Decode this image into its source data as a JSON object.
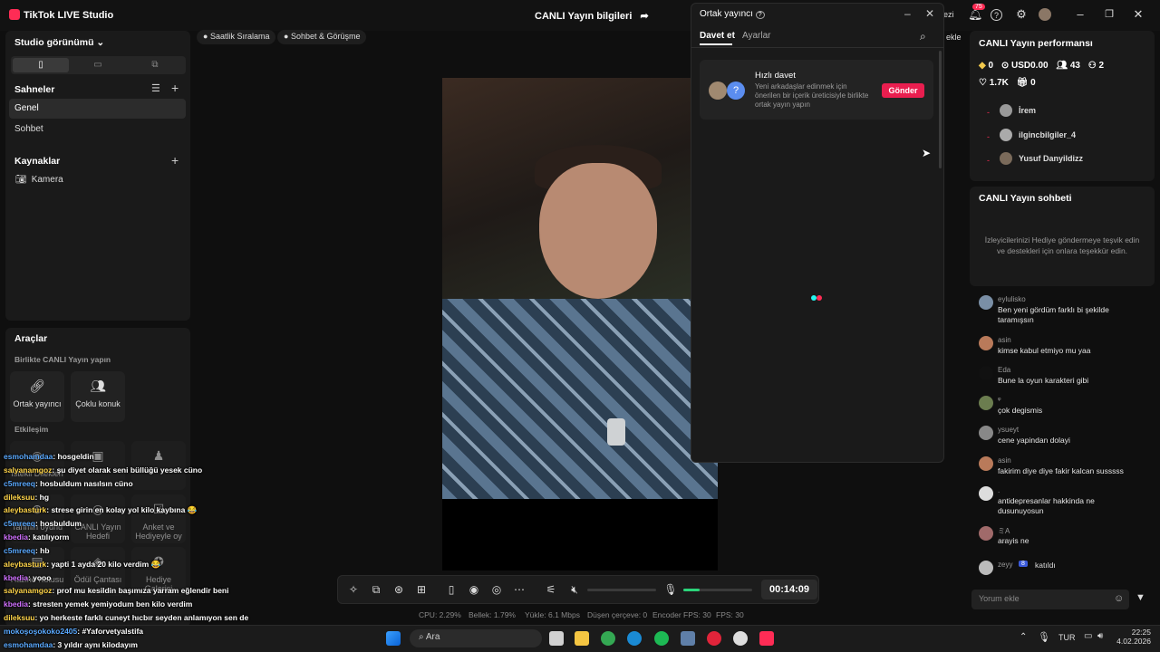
{
  "app": {
    "title": "TikTok LIVE Studio",
    "center_title": "CANLI Yayın bilgileri"
  },
  "top_right": {
    "notif_count": "75",
    "partial_text": "ezi",
    "partial_add": "ekle"
  },
  "left": {
    "studio_view": "Studio görünümü",
    "scenes_title": "Sahneler",
    "scenes": [
      "Genel",
      "Sohbet"
    ],
    "sources_title": "Kaynaklar",
    "sources": [
      "Kamera"
    ],
    "tools_title": "Araçlar",
    "collab_title": "Birlikte CANLI Yayın yapın",
    "collab_tools": [
      "Ortak yayıncı",
      "Çoklu konuk"
    ],
    "interaction_title": "Etkileşim",
    "interaction_tools": [
      "İstekli Dilekleri",
      "",
      "",
      "Tahmin oyunu",
      "CANLI Yayın Hedefi",
      "Anket ve Hediyeyle oy",
      "Hazine Kutusu",
      "Ödül Çantası",
      "Hediye Galerisi"
    ]
  },
  "chips": [
    "Saatlik Sıralama",
    "Sohbet & Görüşme"
  ],
  "modal": {
    "title": "Ortak yayıncı",
    "tabs": [
      "Davet et",
      "Ayarlar"
    ],
    "card_title": "Hızlı davet",
    "card_desc": "Yeni arkadaşlar edinmek için önerilen bir içerik üreticisiyle birlikte ortak yayın yapın",
    "send": "Gönder"
  },
  "controls": {
    "timer": "00:14:09"
  },
  "stats": [
    "CPU: 2.29%",
    "Bellek: 1.79%",
    "Yükle: 6.1 Mbps",
    "Düşen çerçeve: 0",
    "Encoder FPS: 30",
    "FPS: 30"
  ],
  "perf": {
    "title": "CANLI Yayın performansı",
    "diamonds": "0",
    "usd": "USD0.00",
    "viewers": "43",
    "followers": "2",
    "likes": "1.7K",
    "gifts": "0",
    "viewers_list": [
      "İrem",
      "ilgincbilgiler_4",
      "Yusuf Danyildizz"
    ]
  },
  "chat": {
    "title": "CANLI Yayın sohbeti",
    "empty": "İzleyicilerinizi Hediye göndermeye teşvik edin ve destekleri için onlara teşekkür edin.",
    "messages": [
      {
        "user": "eylulisko",
        "text": "Ben yeni gördüm farklı bi şekilde taramışsın"
      },
      {
        "user": "asin",
        "text": "kimse kabul etmiyo mu yaa"
      },
      {
        "user": "Eda",
        "text": "Bune la oyun karakteri gibi"
      },
      {
        "user": "ᵠ",
        "text": "çok degismis"
      },
      {
        "user": "ysueyt",
        "text": "cene yapindan dolayi"
      },
      {
        "user": "asin",
        "text": "fakirim diye diye fakir kalcan susssss"
      },
      {
        "user": ".",
        "text": "antidepresanlar hakkinda ne dusunuyosun"
      },
      {
        "user": "ミA",
        "text": "arayis ne"
      },
      {
        "user": "zeyy",
        "text": "katıldı"
      }
    ],
    "join_badge": "8",
    "comment_placeholder": "Yorum ekle"
  },
  "overlay_chat": [
    {
      "user": "esmohamdaa",
      "text": ": hosgeldin"
    },
    {
      "user": "salyanamgoz",
      "text": ": şu diyet olarak seni büllüğü yesek cüno"
    },
    {
      "user": "c5mreeq",
      "text": ": hosbuldum nasılsın cüno"
    },
    {
      "user": "dileksuu",
      "text": ": hg"
    },
    {
      "user": "aleybasturk",
      "text": ": strese girin en kolay yol kilo kaybına 😂"
    },
    {
      "user": "c5mreeq",
      "text": ": hosbuldum"
    },
    {
      "user": "kbedia",
      "text": ": katılıyorm"
    },
    {
      "user": "c5mreeq",
      "text": ": hb"
    },
    {
      "user": "aleybasturk",
      "text": ": yapti 1 ayda 20 kilo verdim 😂"
    },
    {
      "user": "kbedia",
      "text": ": yooo"
    },
    {
      "user": "salyanamgoz",
      "text": ": prof mu kesildin başımıza yarram eğlendir beni"
    },
    {
      "user": "kbedia",
      "text": ": stresten yemek yemiyodum ben kilo verdim"
    },
    {
      "user": "dileksuu",
      "text": ": yo herkeste farklı cuneyt hıcbır seyden anlamıyon sen de"
    },
    {
      "user": "mokoşoşokoko2405",
      "text": ": #Yaforvetyalstifa"
    },
    {
      "user": "esmohamdaa",
      "text": ": 3 yıldır aynı kilodayım"
    }
  ],
  "taskbar": {
    "search": "Ara",
    "lang": "TUR",
    "time": "22:25",
    "date": "4.02.2026"
  },
  "colors": {
    "accent": "#fe2c55",
    "send": "#e91e4f",
    "live_green": "#2bd47a"
  }
}
